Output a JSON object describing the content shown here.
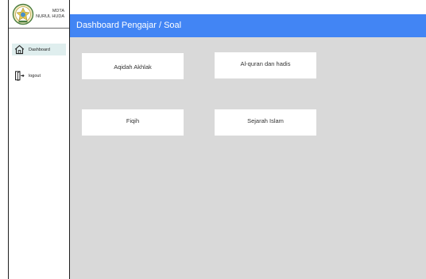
{
  "sidebar": {
    "logo": {
      "icon": "madrasah-emblem-icon",
      "line1": "MDTA",
      "line2": "NURUL HUDA"
    },
    "items": [
      {
        "label": "Dashboard",
        "icon": "home-icon",
        "active": true
      },
      {
        "label": "logout",
        "icon": "logout-door-icon",
        "active": false
      }
    ]
  },
  "header": {
    "title": "Dashboard Pengajar / Soal"
  },
  "main": {
    "cards": [
      {
        "label": "Aqidah Akhlak"
      },
      {
        "label": "Al-quran dan hadis"
      },
      {
        "label": "Fiqih"
      },
      {
        "label": "Sejarah Islam"
      }
    ]
  },
  "colors": {
    "header": "#4285f4",
    "content_bg": "#d9d9d9",
    "active_nav": "#dfeeee",
    "card_bg": "#ffffff"
  }
}
